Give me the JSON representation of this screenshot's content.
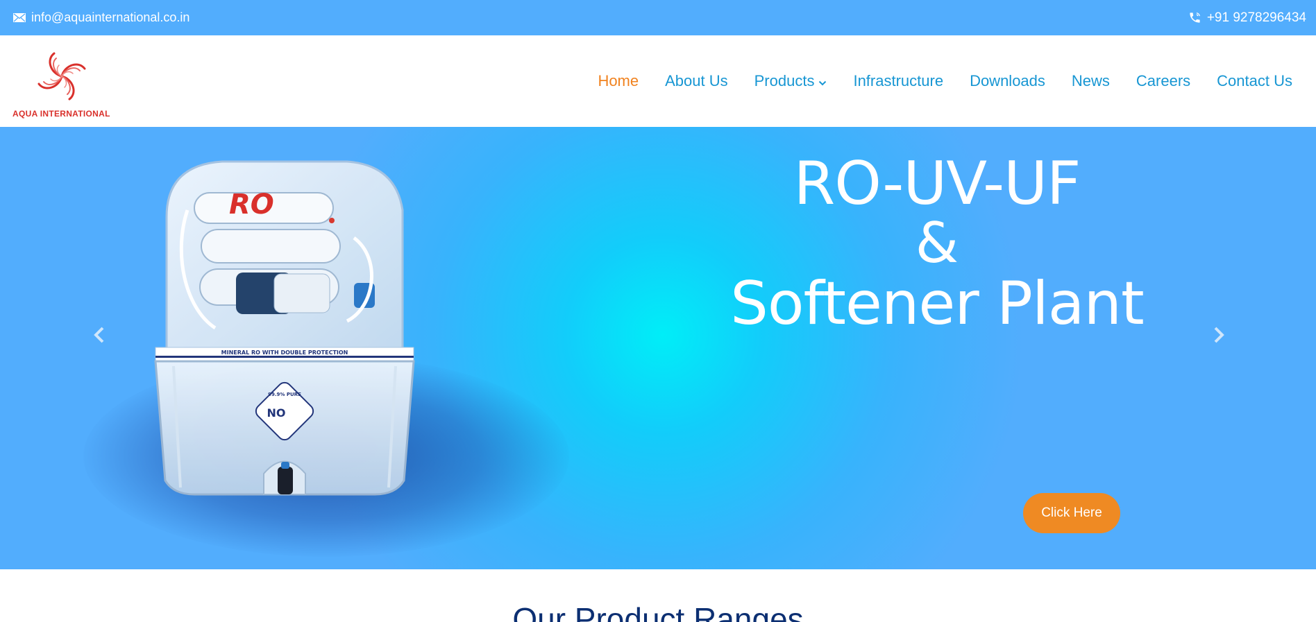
{
  "topbar": {
    "email": "info@aquainternational.co.in",
    "phone": "+91 9278296434",
    "email_icon": "envelope-icon",
    "phone_icon": "phone-icon"
  },
  "brand": {
    "name": "AQUA INTERNATIONAL"
  },
  "nav": {
    "items": [
      {
        "label": "Home",
        "active": true
      },
      {
        "label": "About Us"
      },
      {
        "label": "Products",
        "has_dropdown": true
      },
      {
        "label": "Infrastructure"
      },
      {
        "label": "Downloads"
      },
      {
        "label": "News"
      },
      {
        "label": "Careers"
      },
      {
        "label": "Contact Us"
      }
    ]
  },
  "hero": {
    "line1": "RO-UV-UF",
    "line2": "&",
    "line3": "Softener Plant",
    "cta_label": "Click Here",
    "product_labels": {
      "brand": "RO",
      "band": "MINERAL RO WITH DOUBLE PROTECTION",
      "badge_top": "99.9% PURE",
      "badge_no": "NO"
    }
  },
  "section": {
    "title": "Our Product Ranges"
  },
  "colors": {
    "topbar": "#52adfd",
    "nav_link": "#1796d3",
    "nav_active": "#f0821f",
    "cta": "#ef8a23",
    "heading": "#0c2f72",
    "brand_red": "#d9302b"
  }
}
